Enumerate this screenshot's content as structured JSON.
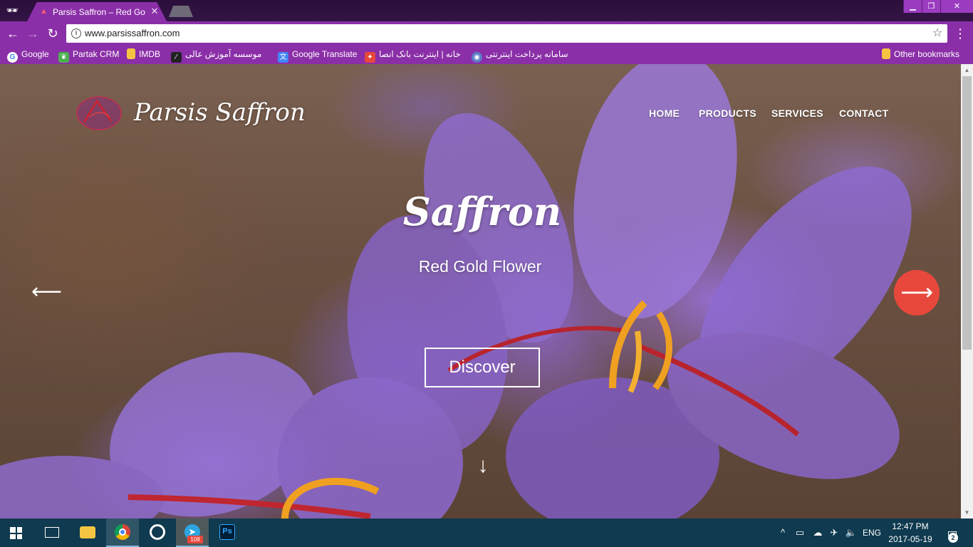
{
  "browser": {
    "tab_title": "Parsis Saffron – Red Gold",
    "tab_close": "✕",
    "url": "www.parsissaffron.com",
    "window_buttons": {
      "minimize": "▁",
      "maximize": "❐",
      "close": "✕"
    }
  },
  "bookmarks": [
    {
      "label": "Google",
      "icon": "google-icon",
      "color": "#4285f4"
    },
    {
      "label": "Partak CRM",
      "icon": "leaf-icon",
      "color": "#4caf50"
    },
    {
      "label": "IMDB",
      "icon": "folder-icon",
      "color": "#f5c542"
    },
    {
      "label": "موسسه آموزش عالی",
      "icon": "chart-icon",
      "color": "#222222"
    },
    {
      "label": "Google Translate",
      "icon": "translate-icon",
      "color": "#4285f4"
    },
    {
      "label": "خانه | اینترنت بانک انصا",
      "icon": "bank-icon",
      "color": "#e8483c"
    },
    {
      "label": "سامانه پرداخت اینترنتی",
      "icon": "payment-icon",
      "color": "#5c7cc8"
    }
  ],
  "other_bookmarks": "Other bookmarks",
  "site": {
    "brand": "Parsis Saffron",
    "nav": [
      "HOME",
      "PRODUCTS",
      "SERVICES",
      "CONTACT"
    ],
    "hero_title": "Saffron",
    "hero_subtitle": "Red Gold Flower",
    "cta": "Discover",
    "accent_color": "#e8483c"
  },
  "taskbar": {
    "apps": [
      {
        "name": "file-explorer-icon",
        "color": "#f4c542"
      },
      {
        "name": "chrome-icon",
        "color": "#db4437"
      },
      {
        "name": "circle-app-icon",
        "color": "#ffffff"
      },
      {
        "name": "telegram-icon",
        "color": "#2ca5e0"
      },
      {
        "name": "photoshop-icon",
        "color": "#31a8ff"
      }
    ],
    "telegram_badge": "108",
    "language": "ENG",
    "time": "12:47 PM",
    "date": "2017-05-19",
    "notifications": "2"
  }
}
